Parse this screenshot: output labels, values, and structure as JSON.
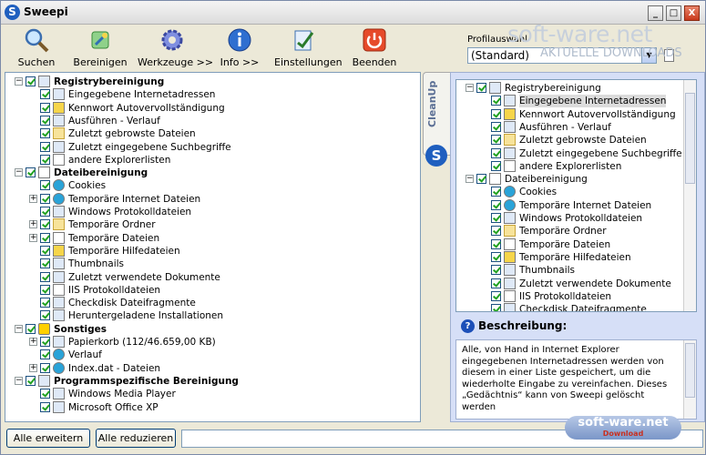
{
  "window": {
    "title": "Sweepi",
    "minimize": "_",
    "maximize": "□",
    "close": "X"
  },
  "toolbar": {
    "buttons": [
      {
        "label": "Suchen",
        "icon": "search-icon"
      },
      {
        "label": "Bereinigen",
        "icon": "broom-icon"
      },
      {
        "label": "Werkzeuge >>",
        "icon": "gear-icon"
      },
      {
        "label": "Info >>",
        "icon": "info-icon"
      },
      {
        "label": "Einstellungen",
        "icon": "settings-icon"
      },
      {
        "label": "Beenden",
        "icon": "power-icon"
      }
    ]
  },
  "profile": {
    "label": "Profilauswahl",
    "selected": "(Standard)"
  },
  "watermark": {
    "top": "soft-ware.net",
    "sub": "AKTUELLE DOWNLOADS",
    "bottom": "soft-ware.net",
    "bottom_sub": "Download"
  },
  "cleanup_tab": {
    "label": "CleanUp",
    "logo": "S"
  },
  "left_tree": [
    {
      "label": "Registrybereinigung",
      "level": 0,
      "bold": true,
      "expander": "-",
      "icon": "registry-icon"
    },
    {
      "label": "Eingegebene Internetadressen",
      "level": 1,
      "icon": "monitor-icon"
    },
    {
      "label": "Kennwort Autovervollständigung",
      "level": 1,
      "icon": "key-icon"
    },
    {
      "label": "Ausführen - Verlauf",
      "level": 1,
      "icon": "run-icon"
    },
    {
      "label": "Zuletzt gebrowste Dateien",
      "level": 1,
      "icon": "folder-icon"
    },
    {
      "label": "Zuletzt eingegebene Suchbegriffe",
      "level": 1,
      "icon": "search-icon"
    },
    {
      "label": "andere Explorerlisten",
      "level": 1,
      "icon": "list-icon"
    },
    {
      "label": "Dateibereinigung",
      "level": 0,
      "bold": true,
      "expander": "-",
      "icon": "file-icon"
    },
    {
      "label": "Cookies",
      "level": 1,
      "icon": "globe-icon"
    },
    {
      "label": "Temporäre Internet Dateien",
      "level": 1,
      "expander": "+",
      "icon": "globe-icon"
    },
    {
      "label": "Windows Protokolldateien",
      "level": 1,
      "icon": "gear-icon"
    },
    {
      "label": "Temporäre Ordner",
      "level": 1,
      "expander": "+",
      "icon": "folder-icon"
    },
    {
      "label": "Temporäre Dateien",
      "level": 1,
      "expander": "+",
      "icon": "file-icon"
    },
    {
      "label": "Temporäre Hilfedateien",
      "level": 1,
      "icon": "help-icon"
    },
    {
      "label": "Thumbnails",
      "level": 1,
      "icon": "image-icon"
    },
    {
      "label": "Zuletzt verwendete Dokumente",
      "level": 1,
      "icon": "clock-icon"
    },
    {
      "label": "IIS Protokolldateien",
      "level": 1,
      "icon": "document-icon"
    },
    {
      "label": "Checkdisk Dateifragmente",
      "level": 1,
      "icon": "disk-icon"
    },
    {
      "label": "Heruntergeladene Installationen",
      "level": 1,
      "icon": "installer-icon"
    },
    {
      "label": "Sonstiges",
      "level": 0,
      "bold": true,
      "expander": "-",
      "icon": "star-icon"
    },
    {
      "label": "Papierkorb (112/46.659,00 KB)",
      "level": 1,
      "expander": "+",
      "icon": "trash-icon"
    },
    {
      "label": "Verlauf",
      "level": 1,
      "icon": "globe-icon"
    },
    {
      "label": "Index.dat - Dateien",
      "level": 1,
      "expander": "+",
      "icon": "globe-icon"
    },
    {
      "label": "Programmspezifische Bereinigung",
      "level": 0,
      "bold": true,
      "expander": "-",
      "icon": "program-icon"
    },
    {
      "label": "Windows Media Player",
      "level": 1,
      "icon": "media-player-icon"
    },
    {
      "label": "Microsoft Office XP",
      "level": 1,
      "icon": "office-icon"
    }
  ],
  "right_tree": [
    {
      "label": "Registrybereinigung",
      "level": 0,
      "expander": "-",
      "icon": "registry-icon"
    },
    {
      "label": "Eingegebene Internetadressen",
      "level": 1,
      "icon": "monitor-icon",
      "selected": true
    },
    {
      "label": "Kennwort Autovervollständigung",
      "level": 1,
      "icon": "key-icon"
    },
    {
      "label": "Ausführen - Verlauf",
      "level": 1,
      "icon": "run-icon"
    },
    {
      "label": "Zuletzt gebrowste Dateien",
      "level": 1,
      "icon": "folder-icon"
    },
    {
      "label": "Zuletzt eingegebene Suchbegriffe",
      "level": 1,
      "icon": "search-icon"
    },
    {
      "label": "andere Explorerlisten",
      "level": 1,
      "icon": "list-icon"
    },
    {
      "label": "Dateibereinigung",
      "level": 0,
      "expander": "-",
      "icon": "file-icon"
    },
    {
      "label": "Cookies",
      "level": 1,
      "icon": "globe-icon"
    },
    {
      "label": "Temporäre Internet Dateien",
      "level": 1,
      "icon": "globe-icon"
    },
    {
      "label": "Windows Protokolldateien",
      "level": 1,
      "icon": "gear-icon"
    },
    {
      "label": "Temporäre Ordner",
      "level": 1,
      "icon": "folder-icon"
    },
    {
      "label": "Temporäre Dateien",
      "level": 1,
      "icon": "file-icon"
    },
    {
      "label": "Temporäre Hilfedateien",
      "level": 1,
      "icon": "help-icon"
    },
    {
      "label": "Thumbnails",
      "level": 1,
      "icon": "image-icon"
    },
    {
      "label": "Zuletzt verwendete Dokumente",
      "level": 1,
      "icon": "clock-icon"
    },
    {
      "label": "IIS Protokolldateien",
      "level": 1,
      "icon": "document-icon"
    },
    {
      "label": "Checkdisk Dateifragmente",
      "level": 1,
      "icon": "disk-icon"
    }
  ],
  "description": {
    "title": "Beschreibung:",
    "text": "Alle, von Hand in Internet Explorer eingegebenen Internetadressen werden von diesem in einer Liste gespeichert, um die wiederholte Eingabe zu vereinfachen. Dieses „Gedächtnis“ kann von Sweepi gelöscht werden"
  },
  "bottom_bar": {
    "expand_all": "Alle erweitern",
    "collapse_all": "Alle reduzieren",
    "status": ""
  }
}
